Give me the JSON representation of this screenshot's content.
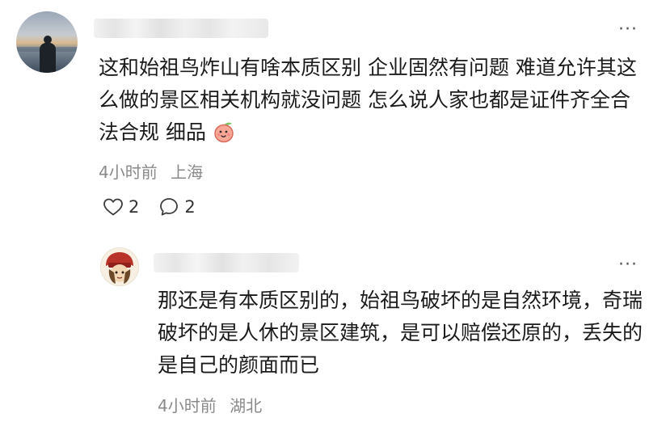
{
  "main_comment": {
    "content": "这和始祖鸟炸山有啥本质区别 企业固然有问题 难道允许其这么做的景区相关机构就没问题 怎么说人家也都是证件齐全合法合规 细品",
    "emoji": "peach-face-emoji",
    "time": "4小时前",
    "location": "上海",
    "like_count": "2",
    "reply_count": "2",
    "more_label": "···"
  },
  "reply": {
    "content": "那还是有本质区别的，始祖鸟破坏的是自然环境，奇瑞破坏的是人休的景区建筑，是可以赔偿还原的，丢失的是自己的颜面而已",
    "time": "4小时前",
    "location": "湖北",
    "more_label": "···"
  },
  "icons": {
    "like": "heart-outline-icon",
    "comment": "speech-bubble-icon",
    "more": "more-dots-icon"
  }
}
